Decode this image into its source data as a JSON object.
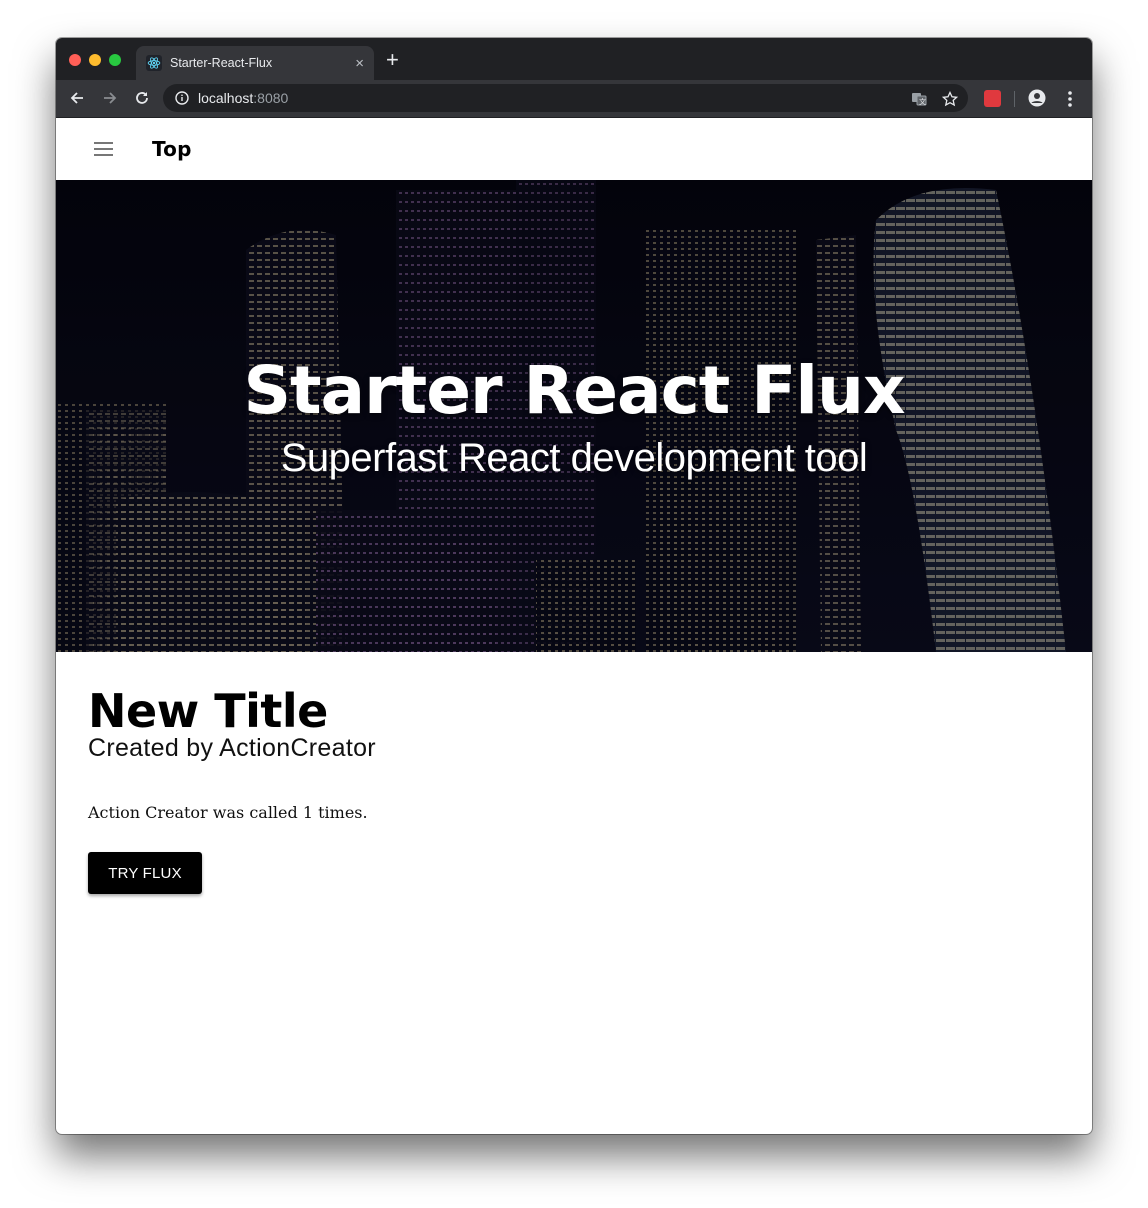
{
  "browser": {
    "tab": {
      "title": "Starter-React-Flux",
      "favicon": "react-logo-icon"
    },
    "new_tab_label": "+",
    "close_tab_label": "×",
    "address": {
      "host": "localhost",
      "port": ":8080"
    },
    "toolbar_icons": [
      "back-icon",
      "forward-icon",
      "reload-icon",
      "info-icon",
      "translate-icon",
      "star-icon",
      "extension-icon",
      "profile-icon",
      "menu-icon"
    ]
  },
  "appbar": {
    "title": "Top",
    "menu_icon": "hamburger-icon"
  },
  "hero": {
    "title": "Starter React Flux",
    "subtitle": "Superfast React development tool"
  },
  "content": {
    "title": "New Title",
    "subtitle": "Created by ActionCreator",
    "called_text": "Action Creator was called 1 times.",
    "button_label": "TRY FLUX"
  },
  "colors": {
    "chrome_dark": "#202124",
    "chrome_toolbar": "#35363a",
    "button_bg": "#000000",
    "hero_overlay": "#06060c"
  }
}
